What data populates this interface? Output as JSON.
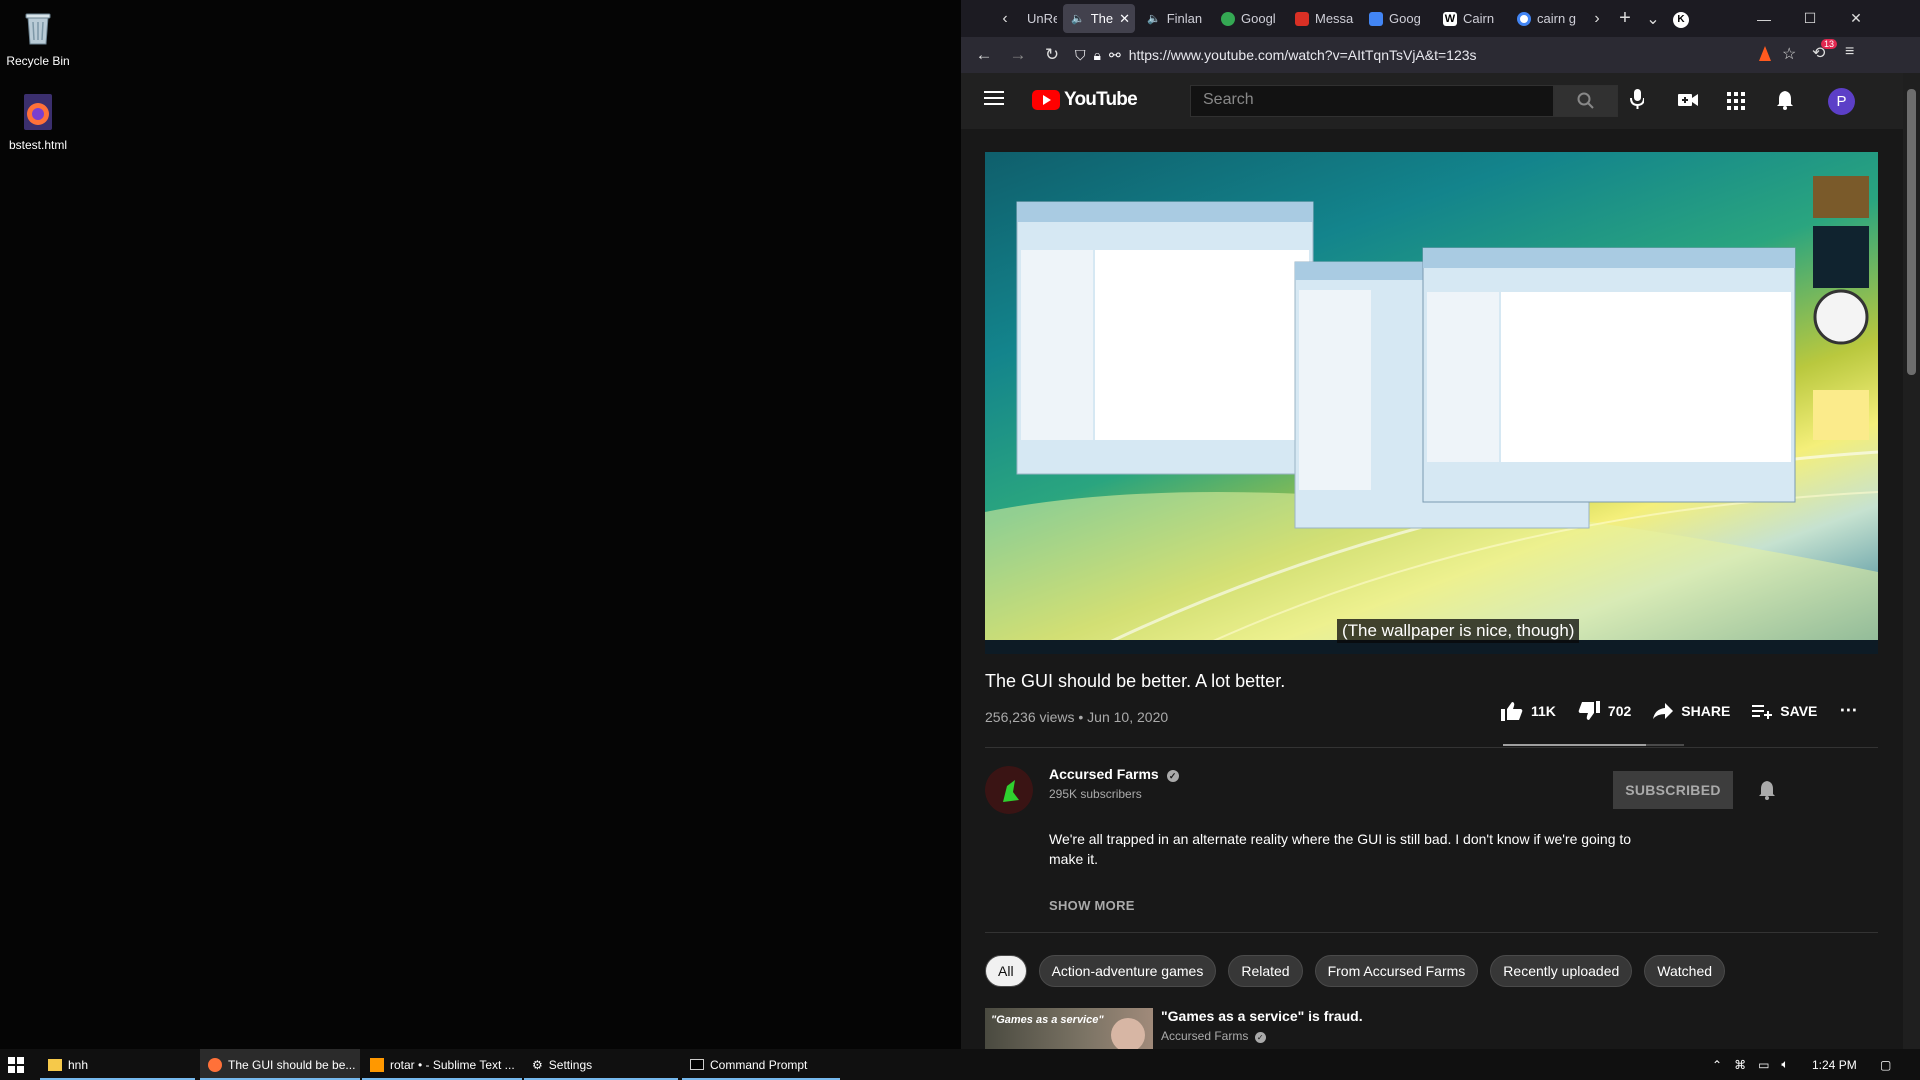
{
  "desktop": {
    "icons": [
      {
        "label": "Recycle Bin"
      },
      {
        "label": "bstest.html"
      }
    ]
  },
  "browser": {
    "tabs": [
      {
        "label": "UnRe"
      },
      {
        "label": "The"
      },
      {
        "label": "Finlan"
      },
      {
        "label": "Googl"
      },
      {
        "label": "Messa"
      },
      {
        "label": "Goog"
      },
      {
        "label": "Cairn"
      },
      {
        "label": "cairn g"
      }
    ],
    "url": "https://www.youtube.com/watch?v=AItTqnTsVjA&t=123s",
    "extension_badge": "13"
  },
  "youtube": {
    "logo_text": "YouTube",
    "search_placeholder": "Search",
    "avatar_letter": "P",
    "caption": "(The wallpaper is nice, though)",
    "video_title": "The GUI should be better. A lot better.",
    "views_date": "256,236 views • Jun 10, 2020",
    "likes": "11K",
    "dislikes": "702",
    "share": "SHARE",
    "save": "SAVE",
    "like_ratio": 0.79,
    "channel_name": "Accursed Farms",
    "subscribers": "295K subscribers",
    "subscribe_state": "SUBSCRIBED",
    "description": "We're all trapped in an alternate reality where the GUI is still bad.  I don't know if we're going to make it.",
    "show_more": "SHOW MORE",
    "chips": [
      "All",
      "Action-adventure games",
      "Related",
      "From Accursed Farms",
      "Recently uploaded",
      "Watched"
    ],
    "rec": {
      "thumb_text": "\"Games as a service\"",
      "title": "\"Games as a service\" is fraud.",
      "channel": "Accursed Farms"
    }
  },
  "taskbar": {
    "items": [
      {
        "label": "hnh"
      },
      {
        "label": "The GUI should be be..."
      },
      {
        "label": "rotar • - Sublime Text ..."
      },
      {
        "label": "Settings"
      },
      {
        "label": "Command Prompt"
      }
    ],
    "time": "1:24 PM"
  },
  "colors": {
    "yt_red": "#ff0000",
    "yt_bg": "#181818",
    "avatar_purple": "#5c3fc7"
  }
}
